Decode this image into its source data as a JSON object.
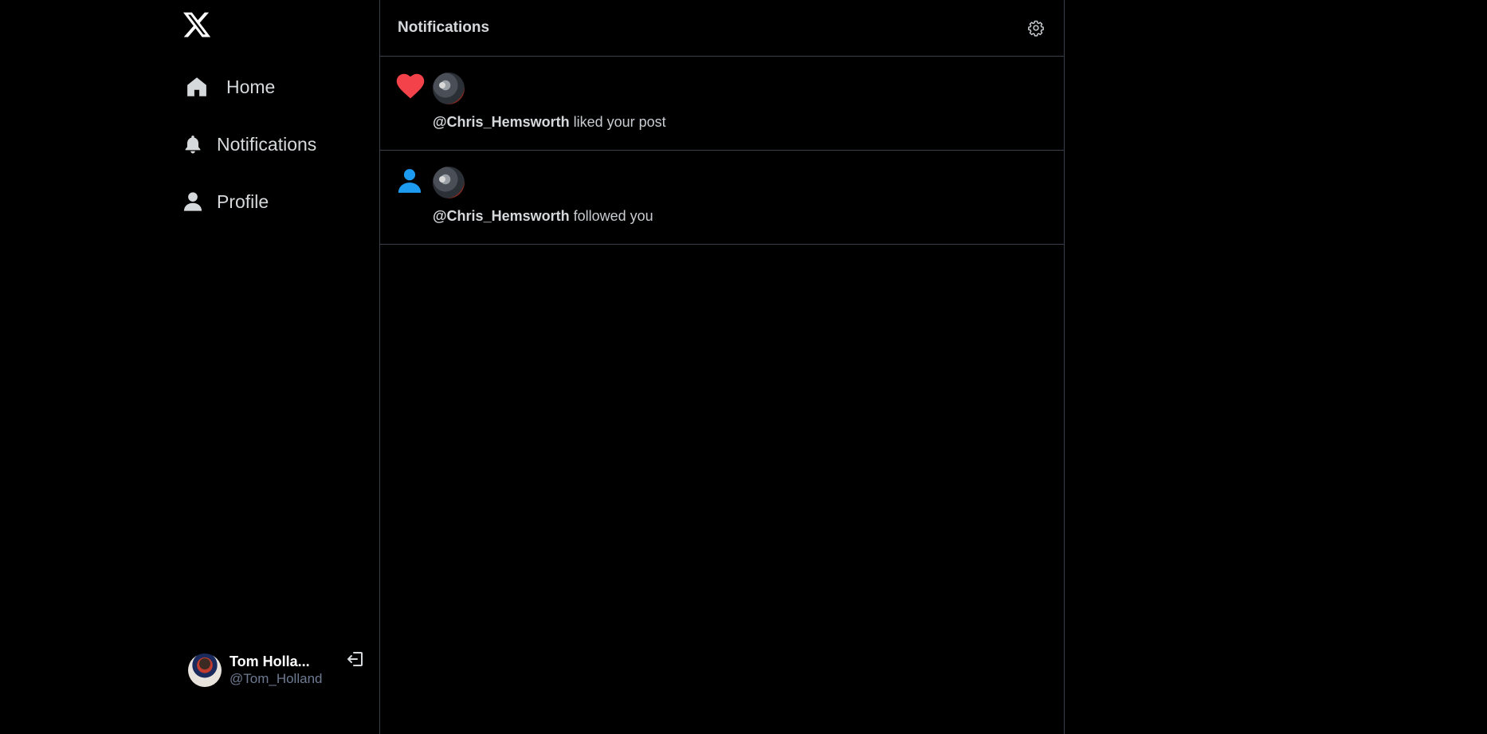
{
  "sidebar": {
    "logo_icon": "x-logo-icon",
    "items": [
      {
        "label": "Home",
        "icon": "home-icon"
      },
      {
        "label": "Notifications",
        "icon": "bell-icon"
      },
      {
        "label": "Profile",
        "icon": "user-icon"
      }
    ],
    "account": {
      "name": "Tom Holla...",
      "handle": "@Tom_Holland",
      "logout_icon": "logout-icon"
    }
  },
  "main": {
    "title": "Notifications",
    "settings_icon": "gear-icon",
    "notifications": [
      {
        "type_icon": "heart-icon",
        "type_color": "#f4424a",
        "user": "@Chris_Hemsworth",
        "action": " liked your post"
      },
      {
        "type_icon": "person-icon",
        "type_color": "#1d9bf0",
        "user": "@Chris_Hemsworth",
        "action": " followed you"
      }
    ]
  },
  "colors": {
    "background": "#000000",
    "border": "#3a3f4b",
    "text": "#d6d9db",
    "handle": "#6e7a91",
    "like": "#f4424a",
    "follow": "#1d9bf0"
  }
}
